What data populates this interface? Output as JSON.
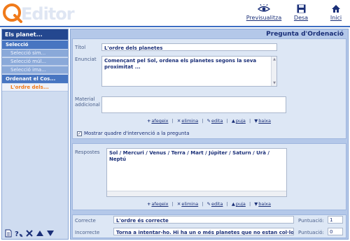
{
  "header": {
    "logo_text": "Editor",
    "buttons": [
      {
        "label": "Previsualitza",
        "icon": "eye-icon"
      },
      {
        "label": "Desa",
        "icon": "save-icon"
      },
      {
        "label": "Inici",
        "icon": "home-icon"
      }
    ]
  },
  "sidebar": {
    "title": "Els planet...",
    "sections": [
      {
        "label": "Selecció",
        "items": [
          "Selecció sim...",
          "Selecció múl...",
          "Selecció ima..."
        ]
      },
      {
        "label": "Ordenant el Cos...",
        "items": [
          "L'ordre dels..."
        ]
      }
    ],
    "active_item": "L'ordre dels...",
    "tools": [
      "new-page-icon",
      "help-icon",
      "delete-icon",
      "move-up-icon",
      "move-down-icon"
    ]
  },
  "main": {
    "title": "Pregunta d'Ordenació",
    "question": {
      "title_label": "Títol",
      "title_value": "L'ordre dels planetes",
      "statement_label": "Enunciat",
      "statement_value": "Començant pel Sol, ordena els planetes segons la seva proximitat ...",
      "material_label": "Material addicional",
      "material_value": "",
      "actions": [
        "afegeix",
        "elimina",
        "edita",
        "puja",
        "baixa"
      ],
      "checkbox_label": "Mostrar quadre d'intervenció a la pregunta",
      "checkbox_checked": true
    },
    "answers": {
      "label": "Respostes",
      "value": "Sol / Mercuri / Venus / Terra / Mart / Júpiter / Saturn / Urà / Neptú",
      "actions": [
        "afegeix",
        "elimina",
        "edita",
        "puja",
        "baixa"
      ]
    },
    "feedback": {
      "correct_label": "Correcte",
      "correct_value": "L'ordre és correcte",
      "incorrect_label": "Incorrecte",
      "incorrect_value": "Torna a intentar-ho. Hi ha un o més planetes que no estan col·locats",
      "score_label": "Puntuació:",
      "correct_score": "1",
      "incorrect_score": "0"
    }
  },
  "colors": {
    "header_rule": "#3b6cc2",
    "sidebar_title": "#24478f",
    "section": "#4775c1",
    "active_item": "#f07a1a",
    "main_bg": "#b4c8e9"
  }
}
